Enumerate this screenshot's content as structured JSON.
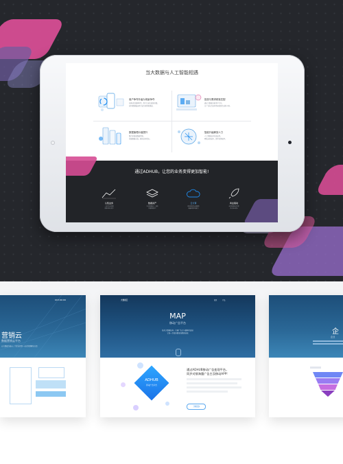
{
  "colors": {
    "accent_pink": "#d64d93",
    "accent_blue": "#1f8df0",
    "dark_bg": "#25272c",
    "card_header": "#2a6796"
  },
  "screen": {
    "title": "当大数据与人工智能相遇",
    "features": [
      {
        "title": "用户争夺升级为场景争夺",
        "desc1": "在移动互联网时代，用户注意力逐渐分散，",
        "desc2": "如何精准触达用户成为营销新挑战。",
        "icon": "phone-chart-icon"
      },
      {
        "title": "投放与需求精准匹配",
        "desc1": "通过大数据分析用户行为，",
        "desc2": "让广告在合适的场景找到合适的人群。",
        "icon": "screen-dashboard-icon"
      },
      {
        "title": "数据管理价值提升",
        "desc1": "整合多维度数据资源，",
        "desc2": "挖掘数据价值，驱动业务增长。",
        "icon": "server-database-icon"
      },
      {
        "title": "智能升级解放人力",
        "desc1": "人工智能技术全面应用，",
        "desc2": "降低运营成本，提升营销效率。",
        "icon": "brain-chip-icon"
      }
    ],
    "band_title": "通过ADHUB，让您的业务变得更加智能!",
    "band_items": [
      {
        "label": "认知业务",
        "d1": "一站式分析洞察",
        "d2": "洞察市场与用户",
        "icon": "chart-line-icon"
      },
      {
        "label": "数据资产",
        "d1": "多方数据融合，高效",
        "d2": "构建数据资产",
        "icon": "stack-icon"
      },
      {
        "label": "云计算",
        "d1": "稳定高效的云端服务",
        "d2": "海量数据处理能力",
        "icon": "cloud-icon"
      },
      {
        "label": "商业驱动",
        "d1": "业务数据驱动决策",
        "d2": "助力商业增长",
        "icon": "rocket-icon"
      }
    ]
  },
  "cards": {
    "left": {
      "title": "营销云",
      "subtitle": "数据营销云平台",
      "nav": "400 8 000 000",
      "para": "以大数据为核心，为企业提供一站式营销解决方案"
    },
    "middle": {
      "logo": "大数据云",
      "nav1": "首页",
      "nav2": "产品",
      "title": "MAP",
      "subtitle": "移动广告平台",
      "desc1": "依托大数据技术，打通广告主与媒体的连接",
      "desc2": "让每一次投放都更加精准高效",
      "diamond_title": "ADHUB",
      "diamond_sub": "移动广告平台",
      "headline1": "通过ADHUB移动广告变现平台，",
      "headline2": "同步对接海量广告主及移动APP!",
      "button": "了解更多"
    },
    "right": {
      "title": "企",
      "subtitle": "企业"
    }
  }
}
